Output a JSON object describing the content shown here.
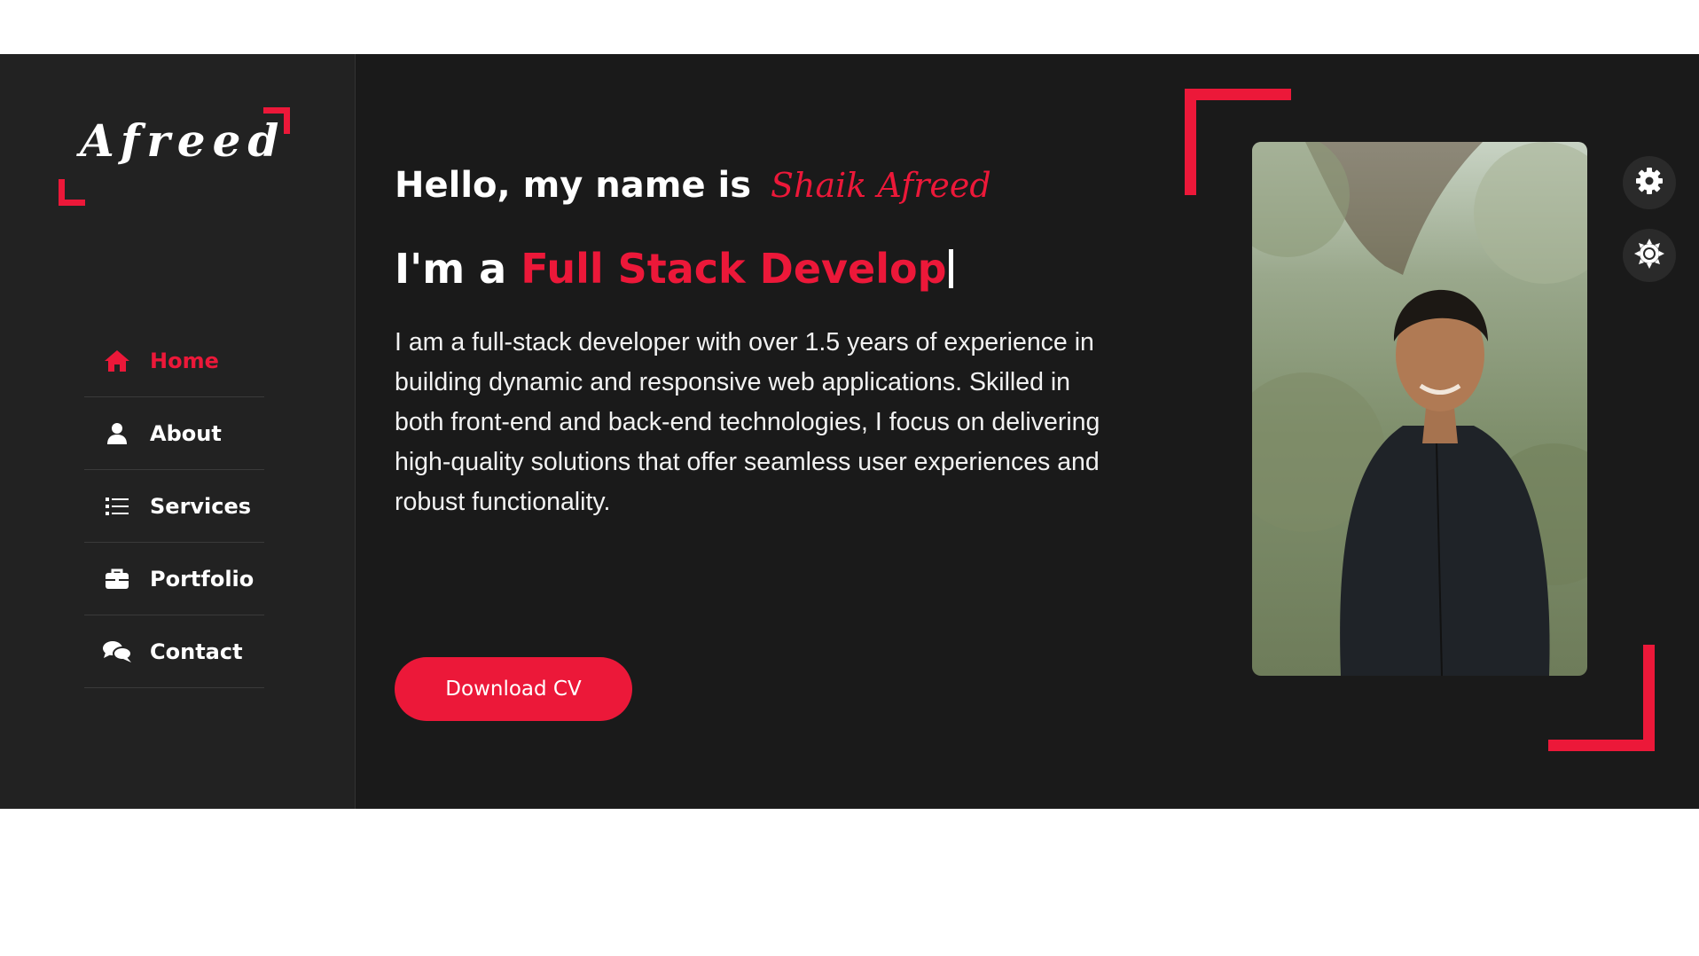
{
  "logo": {
    "text": "Afreed"
  },
  "nav": {
    "items": [
      {
        "label": "Home",
        "icon": "home-icon",
        "active": true
      },
      {
        "label": "About",
        "icon": "user-icon",
        "active": false
      },
      {
        "label": "Services",
        "icon": "list-icon",
        "active": false
      },
      {
        "label": "Portfolio",
        "icon": "briefcase-icon",
        "active": false
      },
      {
        "label": "Contact",
        "icon": "comments-icon",
        "active": false
      }
    ]
  },
  "hero": {
    "greeting": "Hello, my name is",
    "name": "Shaik Afreed",
    "role_prefix": "I'm a",
    "role_typed": "Full Stack Develop",
    "description": "I am a full-stack developer with over 1.5 years of experience in building dynamic and responsive web applications. Skilled in both front-end and back-end technologies, I focus on delivering high-quality solutions that offer seamless user experiences and robust functionality.",
    "cta_label": "Download CV"
  },
  "colors": {
    "accent": "#ec1839",
    "background": "#1a1a1a",
    "sidebar": "#222222"
  },
  "controls": {
    "settings_icon": "gear-icon",
    "theme_icon": "sun-icon"
  }
}
